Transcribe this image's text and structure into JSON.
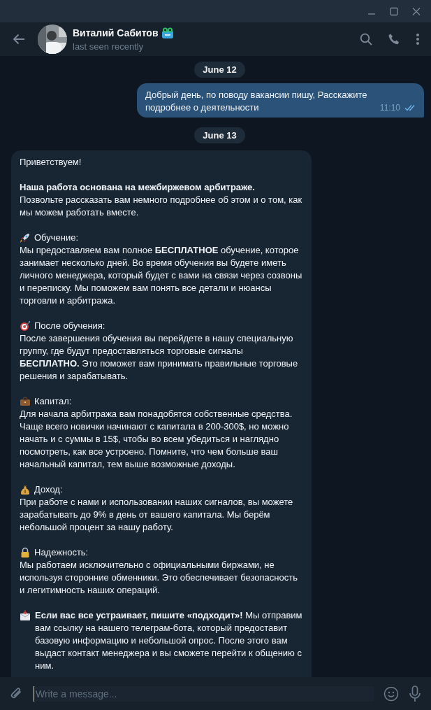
{
  "header": {
    "name": "Виталий Сабитов",
    "status": "last seen recently"
  },
  "messages": [
    {
      "kind": "date",
      "text": "June 12"
    },
    {
      "kind": "outgoing",
      "text": "Добрый день, по поводу вакансии пишу, Расскажите подробнее о деятельности",
      "time": "11:10",
      "read": true
    },
    {
      "kind": "date",
      "text": "June 13"
    },
    {
      "kind": "incoming",
      "paragraphs": [
        {
          "text": "Приветствуем!"
        },
        {
          "text": "**Наша работа основана на межбиржевом арбитраже.**\nПозвольте рассказать вам немного подробнее об этом и о том, как мы можем работать вместе."
        },
        {
          "heading": "Обучение:",
          "text": "Мы предоставляем вам полное **БЕСПЛАТНОЕ**  обучение, которое занимает несколько дней. Во время обучения вы будете иметь личного менеджера, который будет с вами на связи через созвоны и переписку. Мы поможем вам понять все детали и нюансы торговли и арбитража."
        },
        {
          "heading": "После обучения:",
          "text": "После завершения обучения вы перейдете в нашу специальную группу, где будут предоставляться торговые сигналы **БЕСПЛАТНО.** Это поможет вам принимать правильные торговые решения и зарабатывать."
        },
        {
          "heading": "Капитал:",
          "text": "Для начала арбитража вам понадобятся собственные средства. Чаще всего новички начинают с капитала в 200-300$, но можно начать и с суммы в 15$, чтобы во всем убедиться и наглядно посмотреть, как все устроено. Помните, что чем больше ваш начальный капитал, тем выше возможные доходы."
        },
        {
          "heading": "Доход:",
          "text": "При работе с нами и использовании наших сигналов, вы можете зарабатывать до 9% в день от вашего капитала. Мы берём небольшой процент за нашу работу."
        },
        {
          "heading": "Надежность:",
          "text": "Мы работаем исключительно с официальными биржами, не используя сторонние обменники. Это обеспечивает безопасность и легитимность наших операций."
        },
        {
          "text": "**Если вас все устраивает, пишите «подходит»!** Мы отправим вам ссылку на нашего телеграм-бота, который предоставит базовую информацию и небольшой опрос. После этого вам выдаст контакт менеджера и вы сможете перейти к общению с ним."
        }
      ]
    }
  ],
  "composer": {
    "placeholder": "Write a message..."
  }
}
